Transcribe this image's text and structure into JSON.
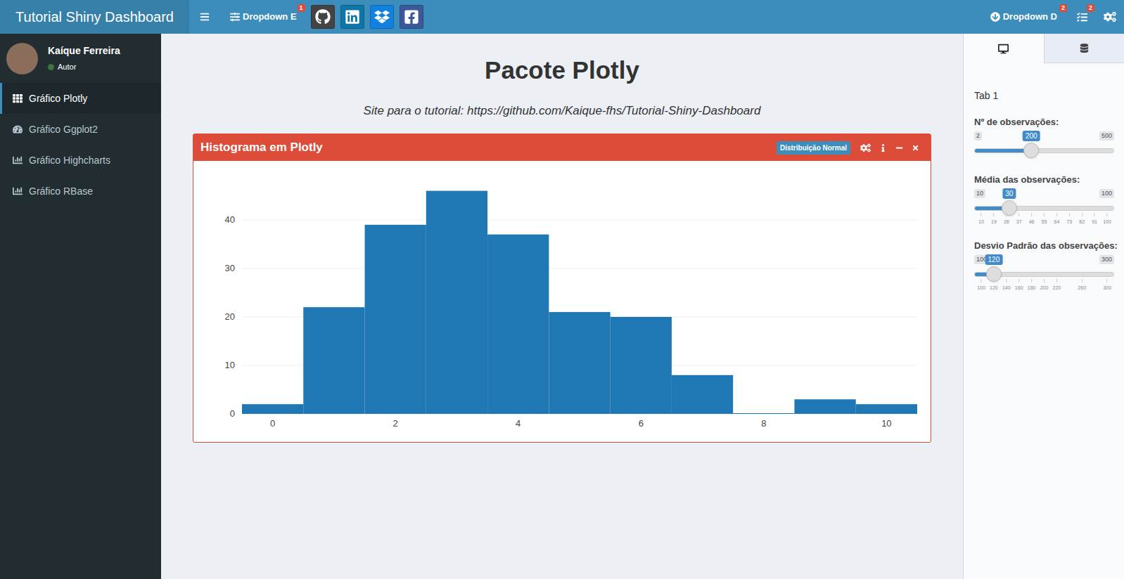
{
  "header": {
    "title": "Tutorial Shiny Dashboard",
    "left_menus": [
      {
        "label": "Dropdown E",
        "badge": "1"
      }
    ],
    "social_links": [
      {
        "kind": "github",
        "color": "#444444"
      },
      {
        "kind": "linkedin",
        "color": "#0e76a8"
      },
      {
        "kind": "dropbox",
        "color": "#1081de"
      },
      {
        "kind": "facebook",
        "color": "#3b5998"
      }
    ],
    "right_menus": [
      {
        "kind": "dropdown",
        "label": "Dropdown D",
        "badge": "2"
      },
      {
        "kind": "tasks",
        "label": "",
        "badge": "2"
      }
    ]
  },
  "user": {
    "name": "Kaíque Ferreira",
    "status": "Autor",
    "online": true
  },
  "sidebar": {
    "items": [
      {
        "label": "Gráfico Plotly",
        "selected": true
      },
      {
        "label": "Gráfico Ggplot2",
        "selected": false
      },
      {
        "label": "Gráfico Highcharts",
        "selected": false
      },
      {
        "label": "Gráfico RBase",
        "selected": false
      }
    ]
  },
  "page": {
    "title": "Pacote Plotly",
    "subtitle": "Site para o tutorial: https://github.com/Kaique-fhs/Tutorial-Shiny-Dashboard"
  },
  "box": {
    "title": "Histograma em Plotly",
    "badge": "Distribuição Normal",
    "chart": {
      "x_start": 0,
      "bin_width": 1,
      "values": [
        2,
        22,
        39,
        46,
        37,
        21,
        20,
        8,
        0,
        3,
        2
      ],
      "y_max": 48.4,
      "x_min": -0.5,
      "x_max": 10.5,
      "y_ticks": [
        "0",
        "10",
        "20",
        "30",
        "40"
      ],
      "x_ticks": [
        "0",
        "2",
        "4",
        "6",
        "8",
        "10"
      ]
    }
  },
  "control_sidebar": {
    "tabs": [
      {
        "kind": "desktop",
        "selected": true
      },
      {
        "kind": "database",
        "selected": false
      }
    ],
    "heading": "Tab 1",
    "sliders": [
      {
        "label": "Nº de observações:",
        "min": "2",
        "max": "500",
        "value": "200",
        "level": 0.398,
        "grid": []
      },
      {
        "label": "Média das observações:",
        "min": "10",
        "max": "100",
        "value": "30",
        "level": 0.222,
        "grid": [
          "10",
          "19",
          "28",
          "37",
          "46",
          "55",
          "64",
          "73",
          "82",
          "91",
          "100"
        ]
      },
      {
        "label": "Desvio Padrão das observações:",
        "min": "100",
        "max": "300",
        "value": "120",
        "level": 0.1,
        "grid": [
          "100",
          "120",
          "140",
          "160",
          "180",
          "200",
          "220",
          "260",
          "300"
        ]
      }
    ]
  }
}
